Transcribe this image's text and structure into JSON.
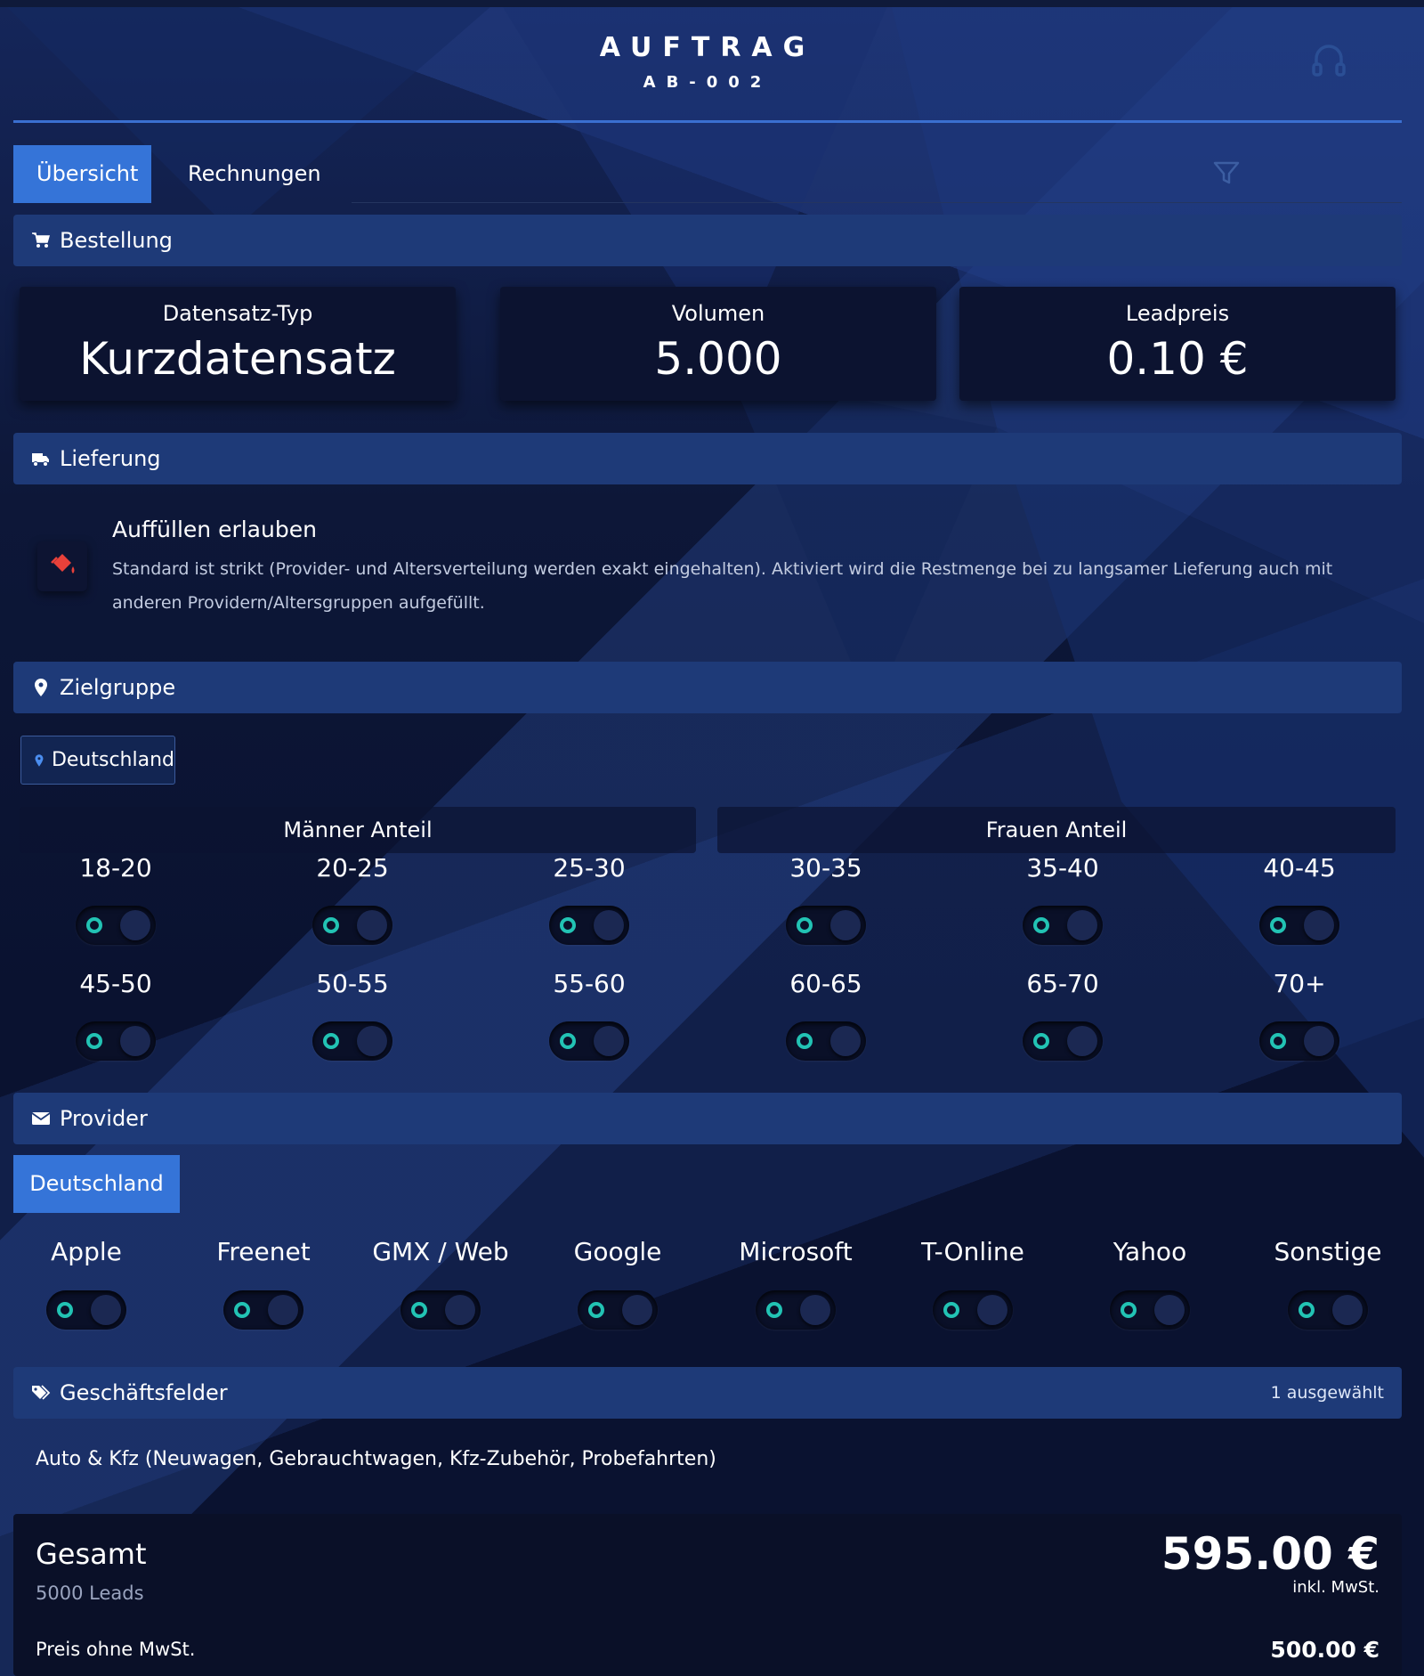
{
  "header": {
    "title": "AUFTRAG",
    "order_id": "AB-002"
  },
  "tabs": [
    {
      "label": "Übersicht",
      "active": true
    },
    {
      "label": "Rechnungen",
      "active": false
    }
  ],
  "sections": {
    "order": "Bestellung",
    "delivery": "Lieferung",
    "target": "Zielgruppe",
    "provider": "Provider",
    "business": "Geschäftsfelder"
  },
  "order": {
    "cards": [
      {
        "label": "Datensatz-Typ",
        "value": "Kurzdatensatz"
      },
      {
        "label": "Volumen",
        "value": "5.000"
      },
      {
        "label": "Leadpreis",
        "value": "0.10 €"
      }
    ]
  },
  "delivery": {
    "title": "Auffüllen erlauben",
    "description": "Standard ist strikt (Provider- und Altersverteilung werden exakt eingehalten). Aktiviert wird die Restmenge bei zu langsamer Lieferung auch mit anderen Providern/Altersgruppen aufgefüllt."
  },
  "target": {
    "country": "Deutschland",
    "male_label": "Männer Anteil",
    "female_label": "Frauen Anteil",
    "age_groups": [
      "18-20",
      "20-25",
      "25-30",
      "30-35",
      "35-40",
      "40-45",
      "45-50",
      "50-55",
      "55-60",
      "60-65",
      "65-70",
      "70+"
    ]
  },
  "provider": {
    "country_tab": "Deutschland",
    "items": [
      "Apple",
      "Freenet",
      "GMX / Web",
      "Google",
      "Microsoft",
      "T-Online",
      "Yahoo",
      "Sonstige"
    ]
  },
  "business": {
    "selected_count": "1 ausgewählt",
    "selected_item": "Auto & Kfz (Neuwagen, Gebrauchtwagen, Kfz-Zubehör, Probefahrten)"
  },
  "total": {
    "title": "Gesamt",
    "leads": "5000 Leads",
    "price": "595.00 €",
    "vat_note": "inkl. MwSt.",
    "net_label": "Preis ohne MwSt.",
    "net_value": "500.00 €"
  },
  "colors": {
    "accent": "#3574d8",
    "section_bar": "#1e3a78",
    "toggle_ring": "#22c3b4",
    "refill_icon": "#e8413a"
  }
}
